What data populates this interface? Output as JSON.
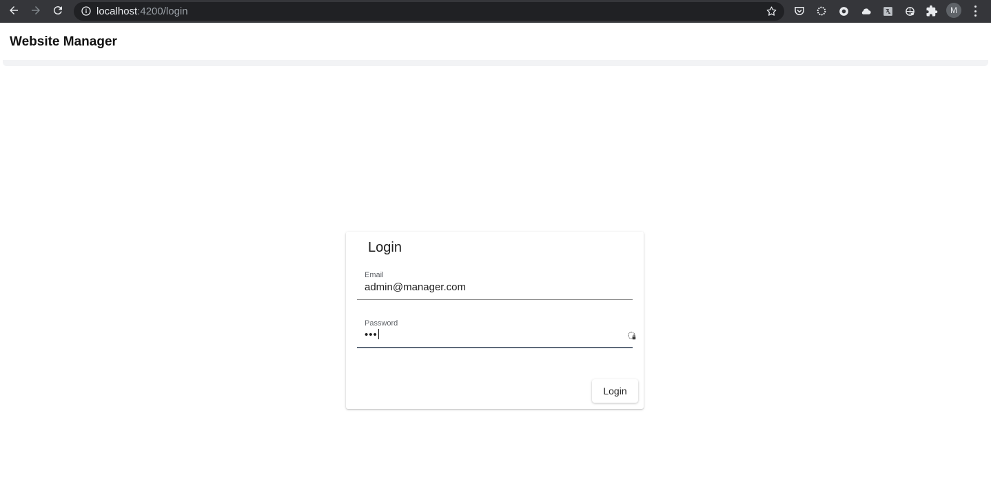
{
  "browser": {
    "url_host": "localhost",
    "url_path": ":4200/login",
    "profile_initial": "M",
    "colors": {
      "chrome_bg": "#35363a",
      "omnibox_bg": "#202124",
      "icon": "#e8eaed"
    },
    "icons": [
      "back-icon",
      "forward-icon",
      "reload-icon",
      "info-icon",
      "star-icon",
      "pocket-icon",
      "extension-icons",
      "puzzle-icon",
      "menu-dots-icon"
    ]
  },
  "app": {
    "title": "Website Manager"
  },
  "login_card": {
    "title": "Login",
    "email_label": "Email",
    "email_value": "admin@manager.com",
    "password_label": "Password",
    "password_masked": "•••",
    "submit_label": "Login"
  }
}
